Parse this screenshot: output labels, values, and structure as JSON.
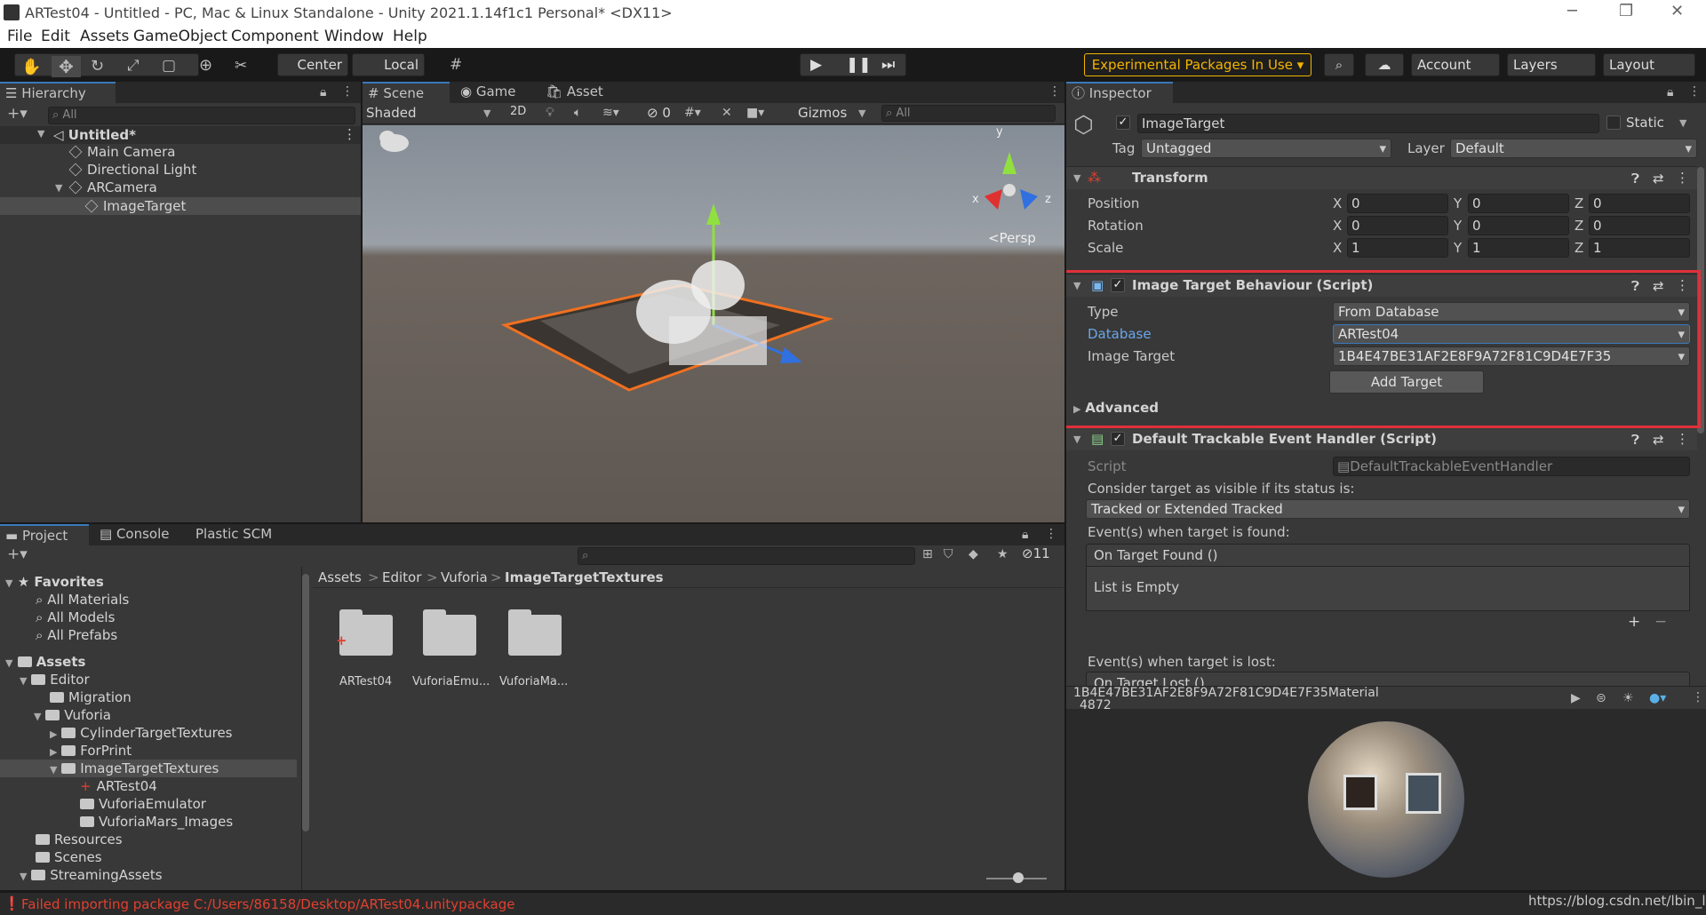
{
  "titlebar": {
    "title": "ARTest04 - Untitled - PC, Mac & Linux Standalone - Unity 2021.1.14f1c1 Personal* <DX11>"
  },
  "menu": [
    "File",
    "Edit",
    "Assets",
    "GameObject",
    "Component",
    "Window",
    "Help"
  ],
  "toolbar": {
    "center": "Center",
    "local": "Local",
    "experimental": "Experimental Packages In Use ▾",
    "account": "Account",
    "layers": "Layers",
    "layout": "Layout"
  },
  "hierarchy": {
    "tab": "Hierarchy",
    "search": "All",
    "scene": "Untitled*",
    "items": [
      "Main Camera",
      "Directional Light",
      "ARCamera",
      "ImageTarget"
    ]
  },
  "scene": {
    "tabs": [
      "Scene",
      "Game",
      "Asset Store"
    ],
    "shading": "Shaded",
    "mode2d": "2D",
    "hidden_count": "0",
    "gizmos": "Gizmos",
    "search": "All",
    "persp": "<Persp",
    "axis_x": "x",
    "axis_y": "y",
    "axis_z": "z"
  },
  "project": {
    "tabs": [
      "Project",
      "Console",
      "Plastic SCM"
    ],
    "hidden_count": "11",
    "favorites": "Favorites",
    "fav_items": [
      "All Materials",
      "All Models",
      "All Prefabs"
    ],
    "assets": "Assets",
    "tree": [
      "Editor",
      "Migration",
      "Vuforia",
      "CylinderTargetTextures",
      "ForPrint",
      "ImageTargetTextures",
      "ARTest04",
      "VuforiaEmulator",
      "VuforiaMars_Images",
      "Resources",
      "Scenes",
      "StreamingAssets"
    ],
    "breadcrumb": [
      "Assets",
      "Editor",
      "Vuforia",
      "ImageTargetTextures"
    ],
    "folders": [
      "ARTest04",
      "VuforiaEmu...",
      "VuforiaMa..."
    ]
  },
  "inspector": {
    "tab": "Inspector",
    "name": "ImageTarget",
    "static": "Static",
    "tag_label": "Tag",
    "tag": "Untagged",
    "layer_label": "Layer",
    "layer": "Default",
    "transform": {
      "title": "Transform",
      "rows": [
        {
          "label": "Position",
          "x": "0",
          "y": "0",
          "z": "0"
        },
        {
          "label": "Rotation",
          "x": "0",
          "y": "0",
          "z": "0"
        },
        {
          "label": "Scale",
          "x": "1",
          "y": "1",
          "z": "1"
        }
      ]
    },
    "itb": {
      "title": "Image Target Behaviour (Script)",
      "type_label": "Type",
      "type": "From Database",
      "db_label": "Database",
      "db": "ARTest04",
      "it_label": "Image Target",
      "it": "1B4E47BE31AF2E8F9A72F81C9D4E7F35",
      "add": "Add Target",
      "advanced": "Advanced"
    },
    "dteh": {
      "title": "Default Trackable Event Handler (Script)",
      "script_label": "Script",
      "script": "DefaultTrackableEventHandler",
      "consider": "Consider target as visible if its status is:",
      "status": "Tracked or Extended Tracked",
      "found_label": "Event(s) when target is found:",
      "found_header": "On Target Found ()",
      "empty": "List is Empty",
      "plus": "+",
      "minus": "−",
      "lost_label": "Event(s) when target is lost:",
      "lost_header": "On Target Lost ()"
    },
    "preview": {
      "title": "1B4E47BE31AF2E8F9A72F81C9D4E7F35Material",
      "sub": "_4872"
    }
  },
  "status": {
    "error": "Failed importing package C:/Users/86158/Desktop/ARTest04.unitypackage",
    "watermark": "https://blog.csdn.net/lbin_lx"
  },
  "colors": {
    "accent": "#3a79bb",
    "highlight": "#e0303a",
    "warning": "#f4b400"
  }
}
